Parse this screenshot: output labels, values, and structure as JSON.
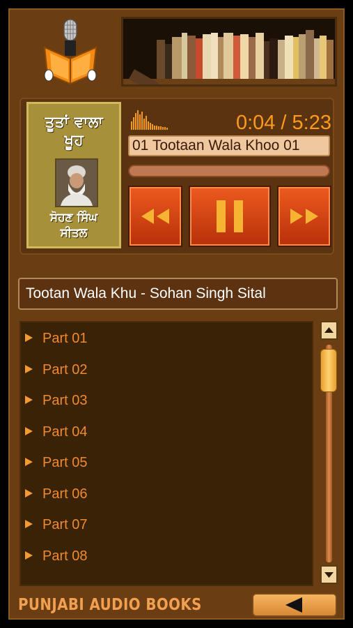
{
  "cover": {
    "title_line1": "ਤੂਤਾਂ ਵਾਲਾ",
    "title_line2": "ਖੂਹ",
    "author_line1": "ਸੋਹਣ ਸਿੰਘ",
    "author_line2": "ਸੀਤਲ"
  },
  "player": {
    "time": "0:04 / 5:23",
    "track": "01 Tootaan Wala Khoo 01",
    "progress": 0.0124
  },
  "book_title": "Tootan Wala Khu - Sohan Singh Sital",
  "parts": [
    "Part 01",
    "Part 02",
    "Part 03",
    "Part 04",
    "Part 05",
    "Part 06",
    "Part 07",
    "Part 08"
  ],
  "footer": {
    "label": "PUNJABI AUDIO BOOKS"
  },
  "icons": {
    "logo": "microphone-book-icon",
    "rewind": "rewind-icon",
    "pause": "pause-icon",
    "forward": "fast-forward-icon",
    "back": "back-arrow-icon",
    "scroll_up": "scroll-up-icon",
    "scroll_down": "scroll-down-icon"
  },
  "colors": {
    "accent": "#ff9a1e",
    "panel": "#6b3d12",
    "list_bg": "#3a2207",
    "button_red": "#d8401a"
  }
}
